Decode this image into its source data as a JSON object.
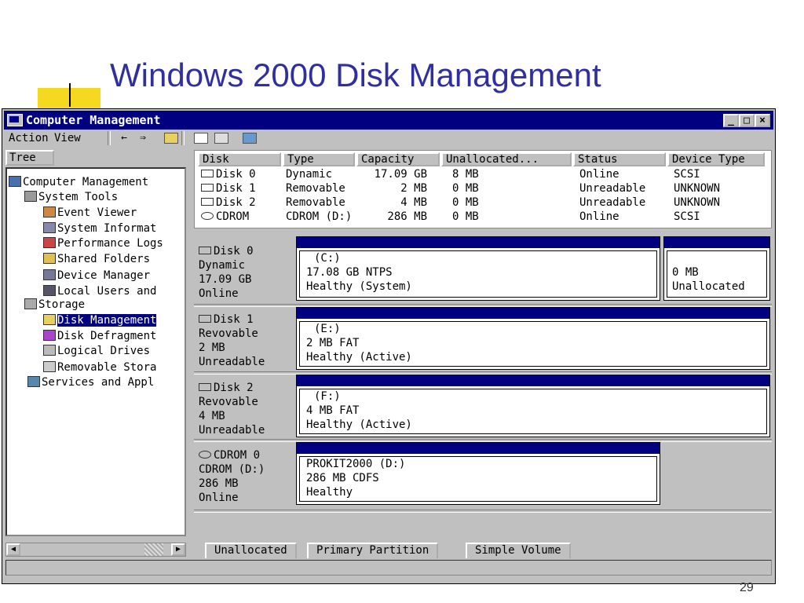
{
  "slide": {
    "title": "Windows 2000 Disk Management",
    "page_number": "29"
  },
  "window": {
    "title": "Computer Management",
    "controls": {
      "minimize": "_",
      "maximize": "□",
      "close": "×"
    }
  },
  "menubar": {
    "action": "Action",
    "view": "View"
  },
  "toolbar": {
    "back": "←",
    "forward": "⇒"
  },
  "tree": {
    "tab_label": "Tree",
    "items": [
      {
        "label": "Computer Management",
        "icon": "computer-icon"
      },
      {
        "label": "System Tools",
        "icon": "tools-icon"
      },
      {
        "label": "Event Viewer",
        "icon": "event-viewer-icon"
      },
      {
        "label": "System Informat",
        "icon": "system-info-icon"
      },
      {
        "label": "Performance Logs",
        "icon": "performance-icon"
      },
      {
        "label": "Shared Folders",
        "icon": "shared-folder-icon"
      },
      {
        "label": "Device Manager",
        "icon": "device-manager-icon"
      },
      {
        "label": "Local Users and",
        "icon": "users-icon"
      },
      {
        "label": "Storage",
        "icon": "storage-icon"
      },
      {
        "label": "Disk Management",
        "icon": "disk-management-icon",
        "selected": true
      },
      {
        "label": "Disk Defragment",
        "icon": "defrag-icon"
      },
      {
        "label": "Logical Drives",
        "icon": "logical-drives-icon"
      },
      {
        "label": "Removable Stora",
        "icon": "removable-storage-icon"
      },
      {
        "label": "Services and Appl",
        "icon": "services-icon"
      }
    ]
  },
  "disk_list": {
    "columns": [
      "Disk",
      "Type",
      "Capacity",
      "Unallocated...",
      "Status",
      "Device Type"
    ],
    "rows": [
      {
        "disk": "Disk 0",
        "type": "Dynamic",
        "capacity": "17.09 GB",
        "unallocated": "8 MB",
        "status": "Online",
        "device_type": "SCSI"
      },
      {
        "disk": "Disk 1",
        "type": "Removable",
        "capacity": "2 MB",
        "unallocated": "0 MB",
        "status": "Unreadable",
        "device_type": "UNKNOWN"
      },
      {
        "disk": "Disk 2",
        "type": "Removable",
        "capacity": "4 MB",
        "unallocated": "0 MB",
        "status": "Unreadable",
        "device_type": "UNKNOWN"
      },
      {
        "disk": "CDROM",
        "type": "CDROM (D:)",
        "capacity": "286 MB",
        "unallocated": "0 MB",
        "status": "Online",
        "device_type": "SCSI"
      }
    ]
  },
  "graphical_view": [
    {
      "label_lines": [
        "Disk 0",
        "Dynamic",
        "17.09 GB",
        "Online"
      ],
      "volumes": [
        {
          "lines": [
            "(C:)",
            "17.08 GB NTPS",
            "Healthy (System)"
          ]
        },
        {
          "lines": [
            "",
            "0 MB",
            "Unallocated"
          ]
        }
      ]
    },
    {
      "label_lines": [
        "Disk 1",
        "Revovable",
        "2 MB",
        "Unreadable"
      ],
      "volumes": [
        {
          "lines": [
            "(E:)",
            "2 MB FAT",
            "Healthy (Active)"
          ]
        }
      ]
    },
    {
      "label_lines": [
        "Disk 2",
        "Revovable",
        "4 MB",
        "Unreadable"
      ],
      "volumes": [
        {
          "lines": [
            "(F:)",
            "4 MB FAT",
            "Healthy (Active)"
          ]
        }
      ]
    },
    {
      "label_lines": [
        "CDROM 0",
        "CDROM (D:)",
        "286 MB",
        "Online"
      ],
      "volumes": [
        {
          "lines": [
            "PROKIT2000 (D:)",
            "286 MB CDFS",
            "Healthy"
          ]
        }
      ]
    }
  ],
  "legend": [
    "Unallocated",
    "Primary Partition",
    "Simple Volume"
  ],
  "colors": {
    "title_bar": "#000080",
    "slide_title": "#2f2fa0",
    "accent_yellow": "#f5d820",
    "chrome": "#c0c0c0"
  }
}
